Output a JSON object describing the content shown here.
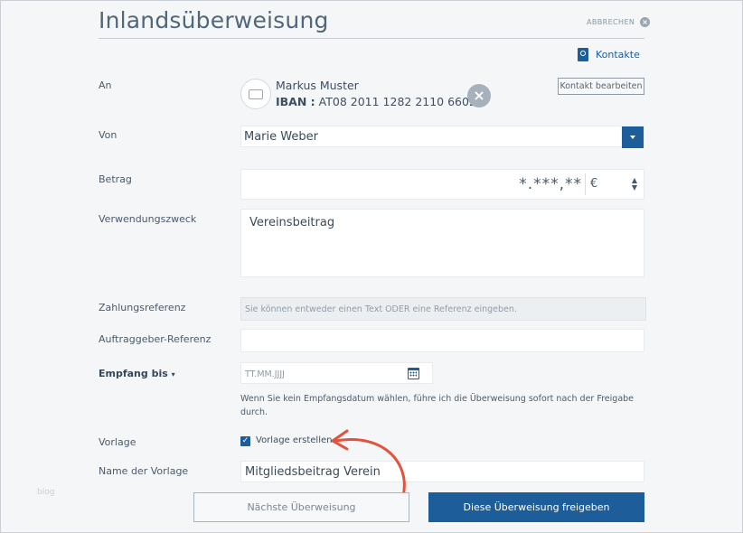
{
  "header": {
    "title": "Inlandsüberweisung",
    "cancel_label": "ABBRECHEN",
    "contacts_label": "Kontakte"
  },
  "recipient": {
    "label": "An",
    "name": "Markus Muster",
    "iban_prefix": "IBAN :",
    "iban": "AT08 2011 1282 2110 6602",
    "edit_button": "Kontakt bearbeiten"
  },
  "sender": {
    "label": "Von",
    "value": "Marie Weber"
  },
  "amount": {
    "label": "Betrag",
    "value": "*.***,**",
    "currency": "€"
  },
  "purpose": {
    "label": "Verwendungszweck",
    "value": "Vereinsbeitrag"
  },
  "payment_reference": {
    "label": "Zahlungsreferenz",
    "placeholder": "Sie können entweder einen Text ODER eine Referenz eingeben."
  },
  "client_reference": {
    "label": "Auftraggeber-Referenz",
    "value": ""
  },
  "receipt_date": {
    "label": "Empfang bis",
    "placeholder": "TT.MM.JJJJ",
    "hint": "Wenn Sie kein Empfangsdatum wählen, führe ich die Überweisung sofort nach der Freigabe durch."
  },
  "template": {
    "label": "Vorlage",
    "checkbox_label": "Vorlage erstellen",
    "checked": true,
    "name_label": "Name der Vorlage",
    "name_value": "Mitgliedsbeitrag Verein"
  },
  "actions": {
    "next_transfer": "Nächste Überweisung",
    "release": "Diese Überweisung freigeben"
  },
  "watermark": "blog",
  "colors": {
    "accent": "#1d5d9a",
    "annotation_arrow": "#e0533e"
  }
}
